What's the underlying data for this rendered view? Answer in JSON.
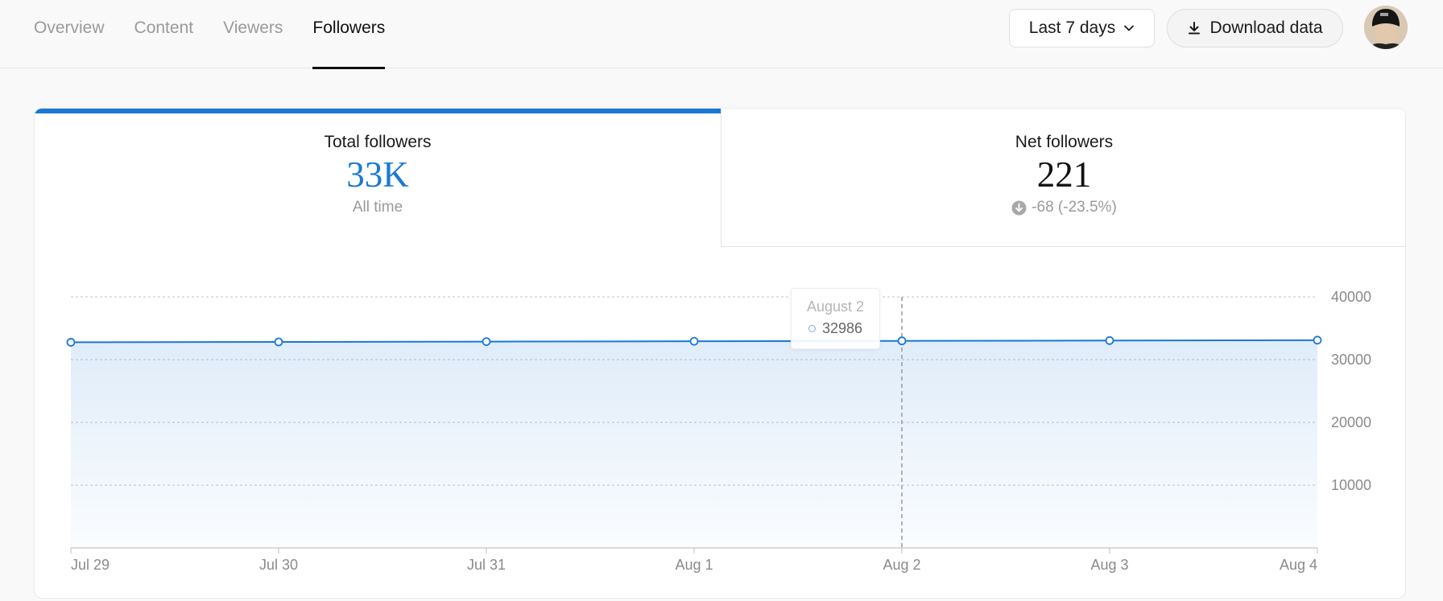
{
  "nav": {
    "tabs": [
      {
        "label": "Overview"
      },
      {
        "label": "Content"
      },
      {
        "label": "Viewers"
      },
      {
        "label": "Followers"
      }
    ],
    "active_tab": "Followers"
  },
  "toolbar": {
    "range_label": "Last 7 days",
    "download_label": "Download data"
  },
  "stats": {
    "total": {
      "label": "Total followers",
      "value": "33K",
      "sub": "All time"
    },
    "net": {
      "label": "Net followers",
      "value": "221",
      "change": "-68 (-23.5%)"
    }
  },
  "tooltip": {
    "date": "August 2",
    "value": "32986"
  },
  "colors": {
    "accent": "#1a78d6",
    "muted": "#9a9a9a"
  },
  "icons": {
    "range": "chevron-down-icon",
    "download": "download-icon",
    "change": "arrow-down-circle-icon"
  },
  "chart_data": {
    "type": "area",
    "x": [
      "Jul 29",
      "Jul 30",
      "Jul 31",
      "Aug 1",
      "Aug 2",
      "Aug 3",
      "Aug 4"
    ],
    "series": [
      {
        "values": [
          32765,
          32820,
          32870,
          32930,
          32986,
          33040,
          33100
        ]
      }
    ],
    "y_ticks": [
      "10000",
      "20000",
      "30000",
      "40000"
    ],
    "ylim": [
      0,
      40000
    ],
    "grid": true,
    "highlight_index": 4
  }
}
